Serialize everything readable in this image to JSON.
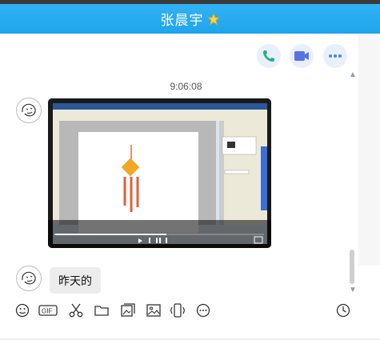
{
  "window": {
    "title": "张晨宇"
  },
  "header_actions": [
    "phone-call",
    "video-call",
    "more"
  ],
  "chat": {
    "timestamp": "9:06:08",
    "video_caption": "",
    "last_message": "昨天的"
  },
  "toolbar_tools": [
    "emoji",
    "gif",
    "scissors",
    "folder",
    "image-gallery",
    "image",
    "shake",
    "more-circle",
    "history"
  ],
  "colors": {
    "titlebar": "#1fa4ec",
    "action_icon": "#20b37f",
    "video_icon": "#5a72e6"
  }
}
